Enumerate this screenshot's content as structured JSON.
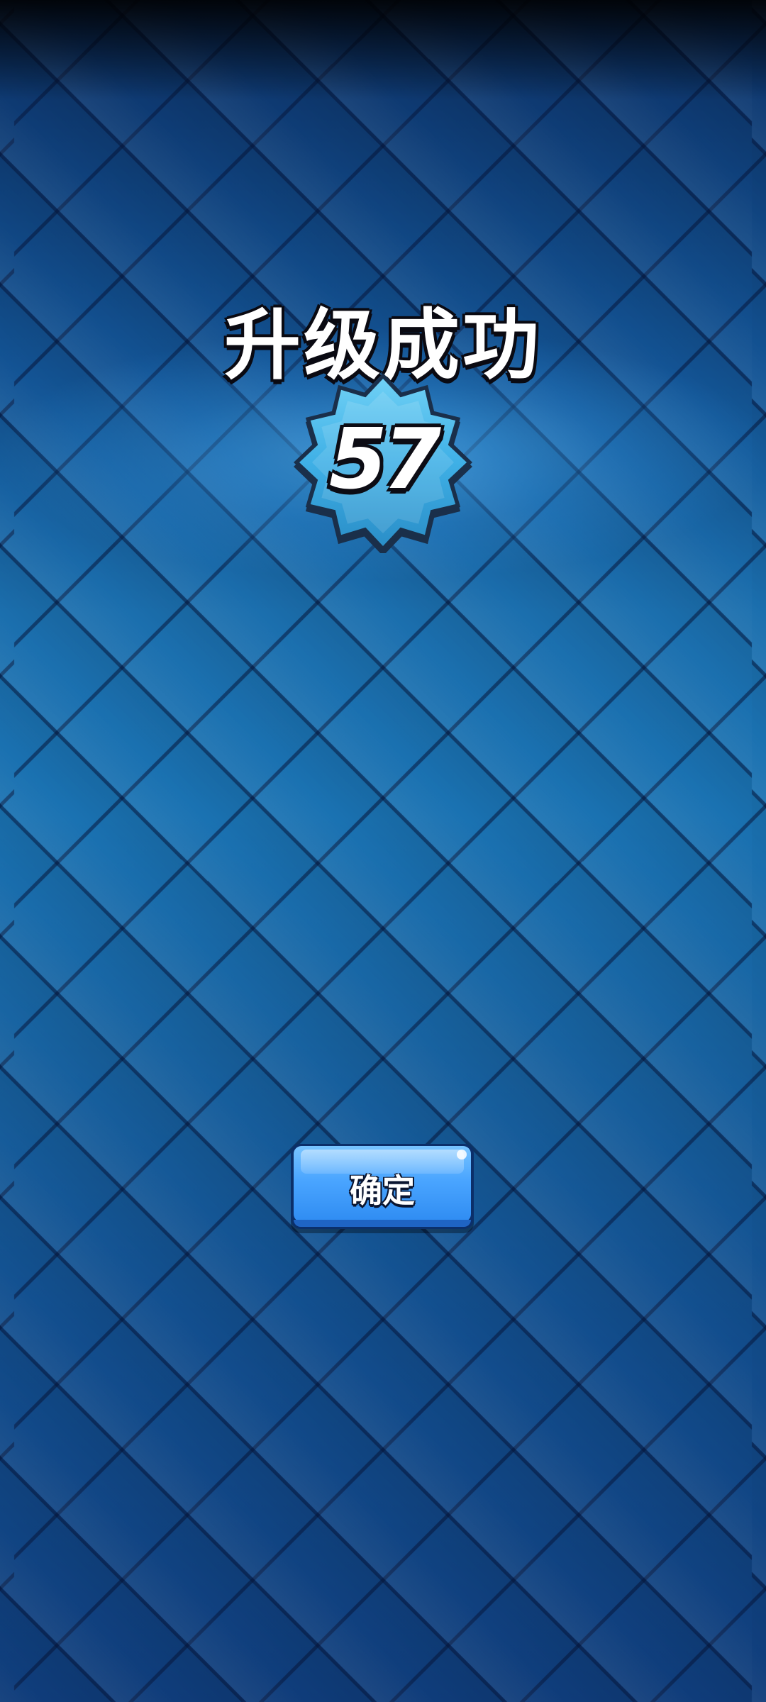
{
  "screen": {
    "title": "升级成功",
    "level": "57",
    "confirm_label": "确定"
  },
  "icons": {
    "level_badge": "star-badge-icon"
  },
  "colors": {
    "background_dark": "#0c3065",
    "background_mid": "#1a72b2",
    "badge_fill": "#3fb0e6",
    "badge_outline": "#1a2f4a",
    "button_fill": "#4aa5ff",
    "button_border": "#0b2f6a",
    "text": "#ffffff",
    "text_outline": "#0a0a12"
  }
}
